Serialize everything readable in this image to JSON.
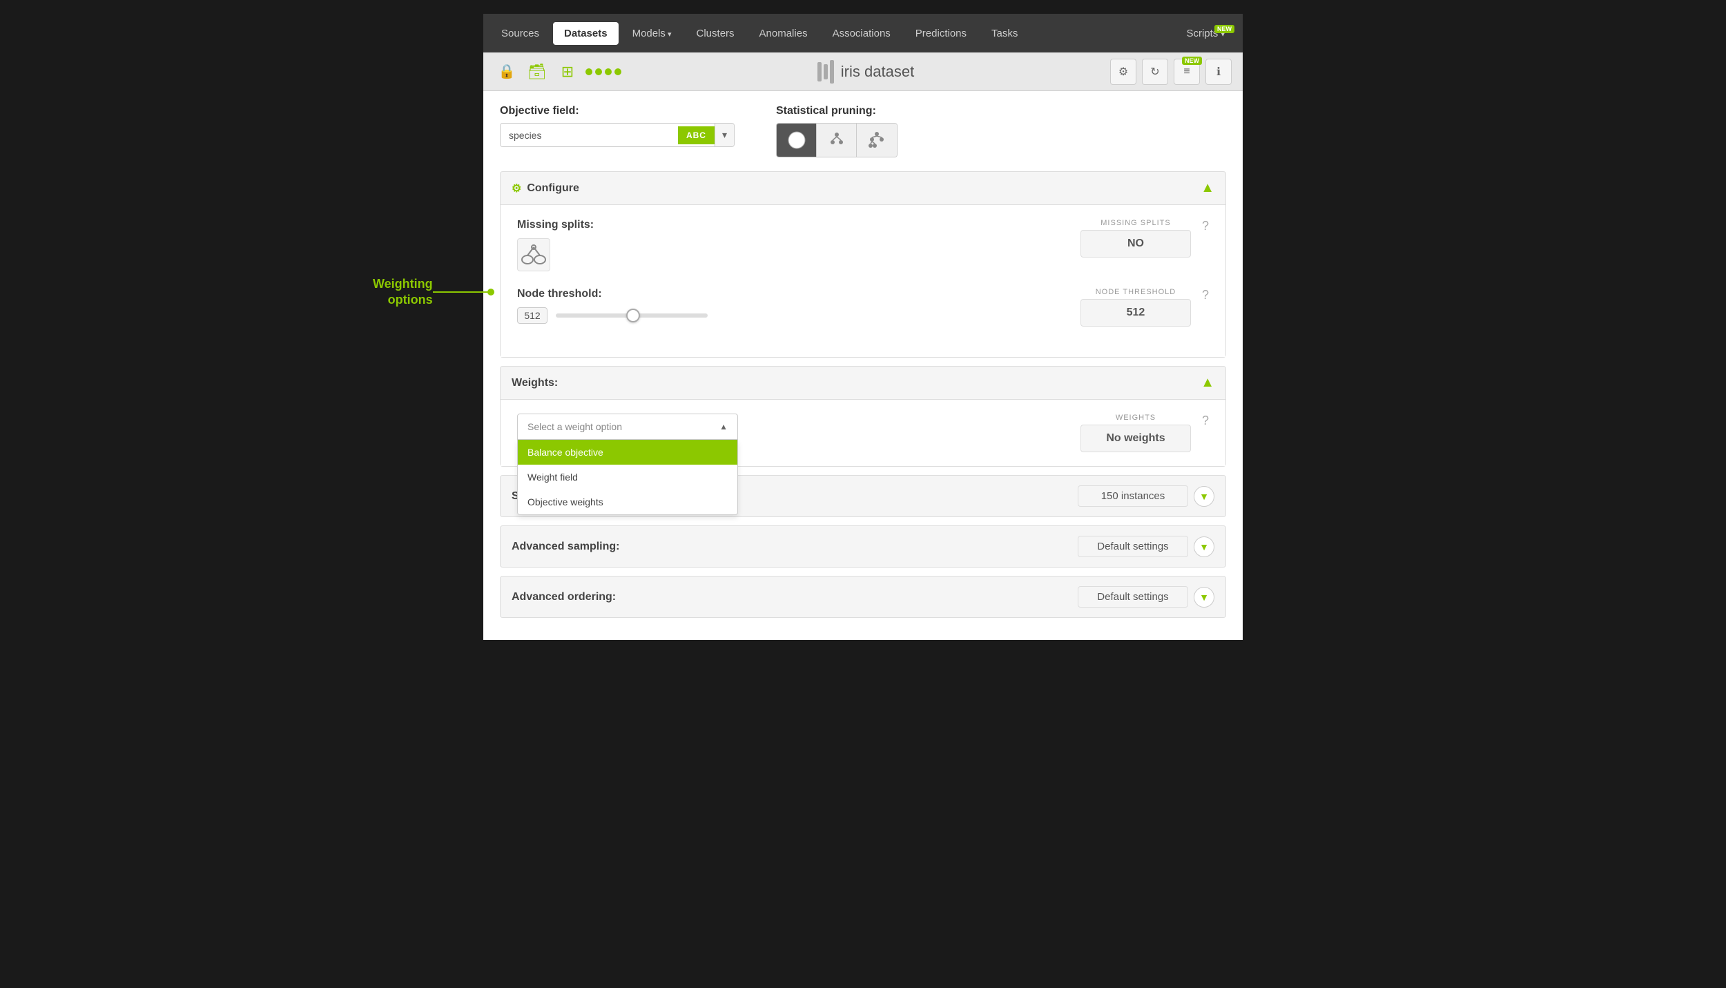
{
  "nav": {
    "items": [
      {
        "label": "Sources",
        "active": false
      },
      {
        "label": "Datasets",
        "active": true
      },
      {
        "label": "Models",
        "active": false,
        "arrow": true
      },
      {
        "label": "Clusters",
        "active": false
      },
      {
        "label": "Anomalies",
        "active": false
      },
      {
        "label": "Associations",
        "active": false
      },
      {
        "label": "Predictions",
        "active": false
      },
      {
        "label": "Tasks",
        "active": false
      }
    ],
    "scripts_label": "Scripts",
    "new_badge": "NEW"
  },
  "toolbar": {
    "title": "iris dataset",
    "new_badge": "NEW"
  },
  "objective_field": {
    "label": "Objective field:",
    "value": "species",
    "type_badge": "ABC",
    "arrow": "▾"
  },
  "statistical_pruning": {
    "label": "Statistical pruning:",
    "buttons": [
      {
        "icon": "ml",
        "active": true
      },
      {
        "icon": "tree1",
        "active": false
      },
      {
        "icon": "tree2",
        "active": false
      }
    ]
  },
  "configure": {
    "section_label": "Configure",
    "missing_splits": {
      "label": "Missing splits:",
      "value": "NO",
      "value_label": "MISSING SPLITS"
    },
    "node_threshold": {
      "label": "Node threshold:",
      "slider_value": "512",
      "display_value": "512",
      "display_label": "NODE THRESHOLD",
      "min": 1,
      "max": 1000
    }
  },
  "weights": {
    "section_label": "Weights:",
    "select_placeholder": "Select a weight option",
    "value": "No weights",
    "value_label": "WEIGHTS",
    "options": [
      {
        "label": "Balance objective",
        "selected": true
      },
      {
        "label": "Weight field",
        "selected": false
      },
      {
        "label": "Objective weights",
        "selected": false
      }
    ]
  },
  "sampling": {
    "section_label": "Sa Objective weights",
    "value": "150 instances"
  },
  "advanced_sampling": {
    "label": "Advanced sampling:",
    "value": "Default settings"
  },
  "advanced_ordering": {
    "label": "Advanced ordering:",
    "value": "Default settings"
  },
  "callout": {
    "text": "Weighting\noptions",
    "line_label": ""
  }
}
